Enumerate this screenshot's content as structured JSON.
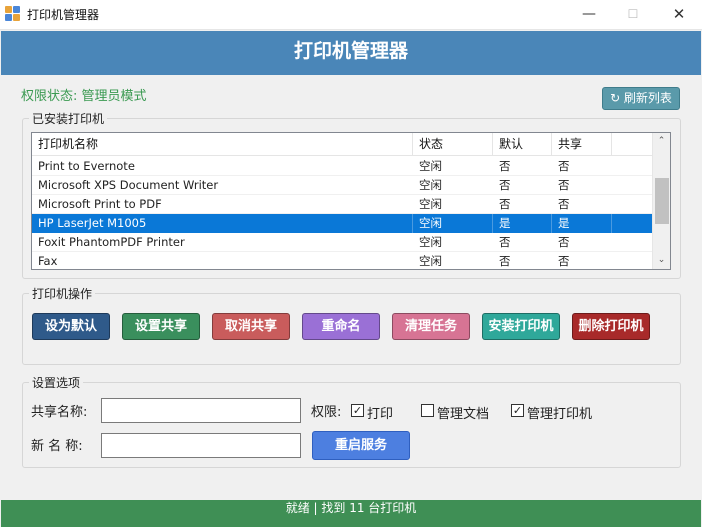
{
  "window": {
    "title": "打印机管理器",
    "min_glyph": "—",
    "max_glyph": "☐",
    "close_glyph": "✕"
  },
  "header": {
    "title": "打印机管理器"
  },
  "permission": {
    "text": "权限状态: 管理员模式",
    "color": "#3b9a52"
  },
  "refresh_button": {
    "label": "↻ 刷新列表"
  },
  "installed": {
    "group_label": "已安装打印机",
    "columns": [
      "打印机名称",
      "状态",
      "默认",
      "共享",
      ""
    ],
    "rows": [
      {
        "name": "Print to Evernote",
        "status": "空闲",
        "default": "否",
        "shared": "否",
        "selected": false
      },
      {
        "name": "Microsoft XPS Document Writer",
        "status": "空闲",
        "default": "否",
        "shared": "否",
        "selected": false
      },
      {
        "name": "Microsoft Print to PDF",
        "status": "空闲",
        "default": "否",
        "shared": "否",
        "selected": false
      },
      {
        "name": "HP LaserJet M1005",
        "status": "空闲",
        "default": "是",
        "shared": "是",
        "selected": true
      },
      {
        "name": "Foxit PhantomPDF Printer",
        "status": "空闲",
        "default": "否",
        "shared": "否",
        "selected": false
      },
      {
        "name": "Fax",
        "status": "空闲",
        "default": "否",
        "shared": "否",
        "selected": false
      }
    ]
  },
  "operations": {
    "group_label": "打印机操作",
    "buttons": [
      {
        "id": "set-default",
        "label": "设为默认",
        "color": "#2f5a8a"
      },
      {
        "id": "set-share",
        "label": "设置共享",
        "color": "#3a8f5d"
      },
      {
        "id": "cancel-share",
        "label": "取消共享",
        "color": "#c95c5c"
      },
      {
        "id": "rename",
        "label": "重命名",
        "color": "#9a70d6"
      },
      {
        "id": "clear-jobs",
        "label": "清理任务",
        "color": "#d77494"
      },
      {
        "id": "install-printer",
        "label": "安装打印机",
        "color": "#2fa89a"
      },
      {
        "id": "delete-printer",
        "label": "删除打印机",
        "color": "#a82a2a"
      }
    ]
  },
  "settings": {
    "group_label": "设置选项",
    "share_name_label": "共享名称:",
    "share_name_value": "",
    "new_name_label": "新 名 称:",
    "new_name_value": "",
    "permission_label": "权限:",
    "checkboxes": [
      {
        "label": "打印",
        "checked": true
      },
      {
        "label": "管理文档",
        "checked": false
      },
      {
        "label": "管理打印机",
        "checked": true
      }
    ],
    "restart_button": "重启服务"
  },
  "status_bar": {
    "text": "就绪 | 找到 11 台打印机",
    "color": "#3f8f55"
  }
}
